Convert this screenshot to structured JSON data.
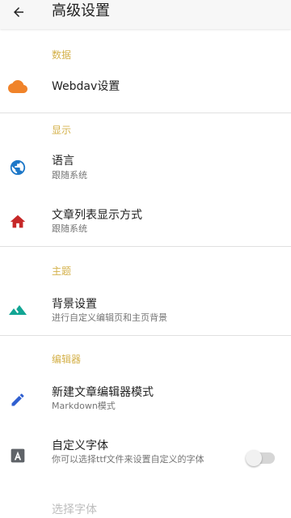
{
  "appbar": {
    "title": "高级设置"
  },
  "sections": {
    "data": {
      "title": "数据",
      "webdav": {
        "title": "Webdav设置"
      }
    },
    "display": {
      "title": "显示",
      "language": {
        "title": "语言",
        "subtitle": "跟随系统"
      },
      "list_style": {
        "title": "文章列表显示方式",
        "subtitle": "跟随系统"
      }
    },
    "theme": {
      "title": "主题",
      "background": {
        "title": "背景设置",
        "subtitle": "进行自定义编辑页和主页背景"
      }
    },
    "editor": {
      "title": "编辑器",
      "editor_mode": {
        "title": "新建文章编辑器模式",
        "subtitle": "Markdown模式"
      },
      "custom_font": {
        "title": "自定义字体",
        "subtitle": "你可以选择ttf文件来设置自定义的字体",
        "enabled": false
      },
      "choose_font": {
        "title": "选择字体"
      }
    }
  },
  "icon_colors": {
    "cloud": "#f0832a",
    "globe": "#1e78c8",
    "home": "#c62828",
    "landscape": "#12a594",
    "pencil": "#2f5fd0",
    "font_box": "#5f6368"
  },
  "icons": [
    "arrow-back",
    "cloud",
    "globe",
    "home",
    "landscape",
    "pencil",
    "font-box"
  ]
}
